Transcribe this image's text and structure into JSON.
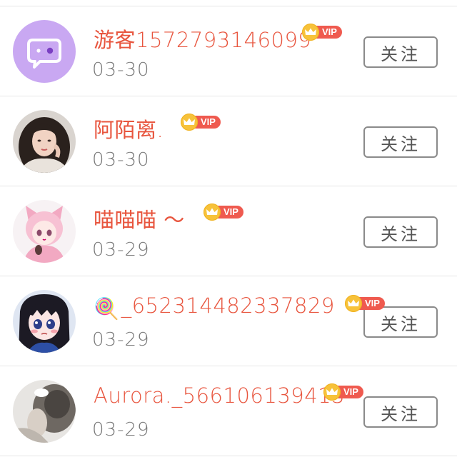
{
  "vip_label": "VIP",
  "follow_label": "关注",
  "colors": {
    "name": "#e8553e",
    "date": "#777777",
    "vip_badge": "#ef5a4f",
    "crown": "#f7c23a",
    "divider": "#e6e6e6",
    "button_border": "#8a8a8a"
  },
  "followers": [
    {
      "name": "游客1572793146099",
      "date": "03-30",
      "avatar": "default-chat-avatar"
    },
    {
      "name": "阿陌离.",
      "date": "03-30",
      "avatar": "woman-photo-avatar"
    },
    {
      "name": "喵喵喵 ～",
      "date": "03-29",
      "avatar": "anime-pink-cat-girl-avatar"
    },
    {
      "name": "_652314482337829",
      "name_emoji": "🍭",
      "date": "03-29",
      "avatar": "anime-dark-hair-girl-avatar"
    },
    {
      "name": "Aurora._566106139413",
      "date": "03-29",
      "avatar": "blurred-photo-avatar"
    }
  ]
}
